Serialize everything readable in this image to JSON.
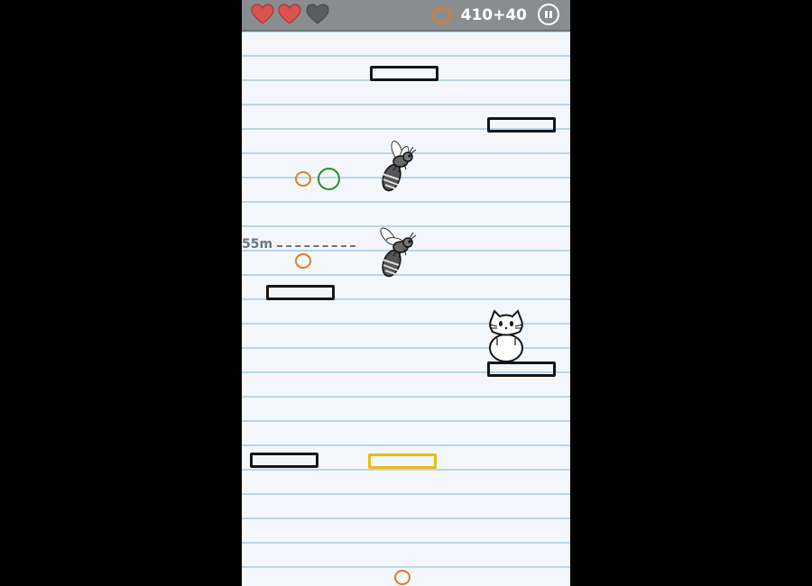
{
  "hud": {
    "hearts": [
      {
        "state": "full",
        "color": "#d9534f"
      },
      {
        "state": "full",
        "color": "#d9534f"
      },
      {
        "state": "empty",
        "color": "#5a5d60"
      }
    ],
    "coin_icon": "coin-icon",
    "score_text": "410+40",
    "pause_icon": "pause-icon"
  },
  "height_marker": {
    "label": "55m"
  },
  "colors": {
    "platform": "#151515",
    "special_platform": "#ebbd12",
    "coin": "#e47a22",
    "green_coin": "#2a8f2a",
    "hud_bar": "#8a8d90",
    "paper_line": "#b9d4ec"
  },
  "entities": {
    "enemies": [
      "wasp",
      "wasp"
    ],
    "player": "cat",
    "platforms": [
      "normal",
      "normal",
      "normal",
      "normal",
      "normal",
      "special"
    ],
    "coins": [
      "orange",
      "green",
      "orange",
      "orange"
    ]
  }
}
